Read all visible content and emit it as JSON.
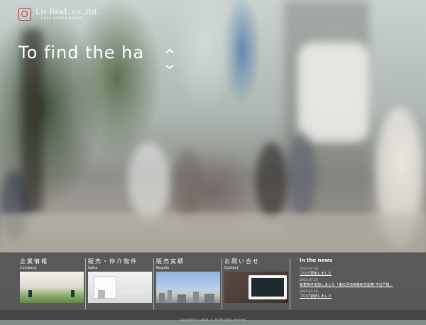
{
  "brand": {
    "name": "Liv.ReaL co.,ltd.",
    "subtitle": "REAL ESTATE AGENT",
    "color": "#c8202a"
  },
  "hero": {
    "tagline": "To find the ha"
  },
  "nav": {
    "items": [
      {
        "label_jp": "企業情報",
        "label_en": "Company",
        "icon": "building-wall-photo"
      },
      {
        "label_jp": "販売・仲介物件",
        "label_en": "Sales",
        "icon": "white-interior-photo"
      },
      {
        "label_jp": "販売実績",
        "label_en": "Results",
        "icon": "city-skyline-photo"
      },
      {
        "label_jp": "お問い合せ",
        "label_en": "Contact",
        "icon": "laptop-photo"
      }
    ]
  },
  "news": {
    "title": "In the news",
    "items": [
      {
        "date": "2024.07.28",
        "text": "ブログ更新しました"
      },
      {
        "date": "2024.07.25",
        "text": "新着物件追加しました「東広島市西条町吉屋敷 中古戸建」"
      },
      {
        "date": "2024.07.19",
        "text": "ブログ更新しました"
      }
    ]
  },
  "footer": {
    "copyright": "Copyright© Liv.ReaL co.,ltd All rights reserved."
  }
}
